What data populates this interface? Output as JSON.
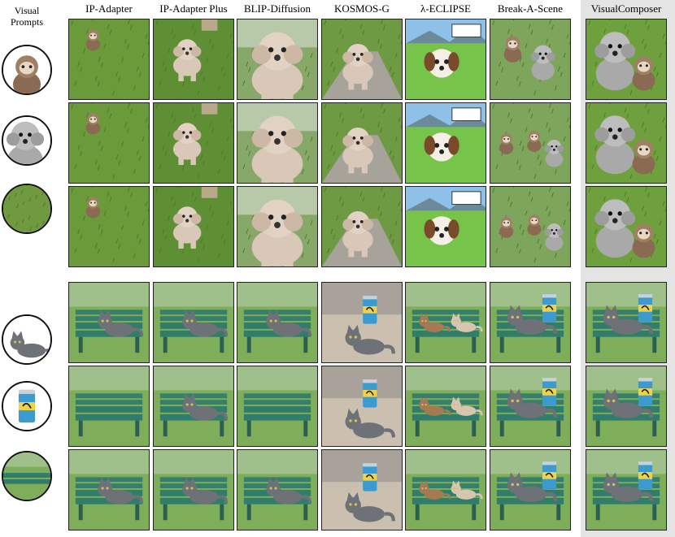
{
  "header": {
    "visual_prompts": "Visual\nPrompts",
    "methods": [
      "IP-Adapter",
      "IP-Adapter Plus",
      "BLIP-Diffusion",
      "KOSMOS-G",
      "λ-ECLIPSE",
      "Break-A-Scene",
      "VisualComposer"
    ]
  },
  "groups": [
    {
      "prompts": [
        "sloth-plush-prompt-icon",
        "poodle-plush-prompt-icon",
        "grass-prompt-icon"
      ],
      "rows": [
        [
          "grass-small-plush",
          "grass-poodle",
          "plush-dog-closeup",
          "poodle-path",
          "cartoon-puppy-sign",
          "two-plush-grass",
          "poodle-sloth-pair"
        ],
        [
          "grass-small-plush",
          "grass-poodle",
          "plush-dog-closeup",
          "poodle-path",
          "cartoon-puppy-sign",
          "three-plush-grass",
          "poodle-sloth-pair"
        ],
        [
          "grass-small-plush",
          "grass-poodle",
          "plush-dog-closeup",
          "poodle-path",
          "cartoon-puppy-sign",
          "three-plush-grass",
          "poodle-sloth-pair"
        ]
      ]
    },
    {
      "prompts": [
        "cat-prompt-icon",
        "can-prompt-icon",
        "bench-prompt-icon"
      ],
      "rows": [
        [
          "cat-on-bench",
          "cat-on-bench",
          "cat-on-bench",
          "cat-can-floor",
          "calico-bench",
          "cat-can-bench",
          "cat-can-bench"
        ],
        [
          "empty-bench",
          "cat-on-bench",
          "empty-bench",
          "cat-can-floor",
          "calico-bench",
          "cat-can-bench",
          "cat-can-bench"
        ],
        [
          "cat-on-bench",
          "cat-on-bench",
          "cat-on-bench",
          "cat-can-floor",
          "calico-bench",
          "cat-can-bench",
          "cat-can-bench"
        ]
      ]
    }
  ]
}
